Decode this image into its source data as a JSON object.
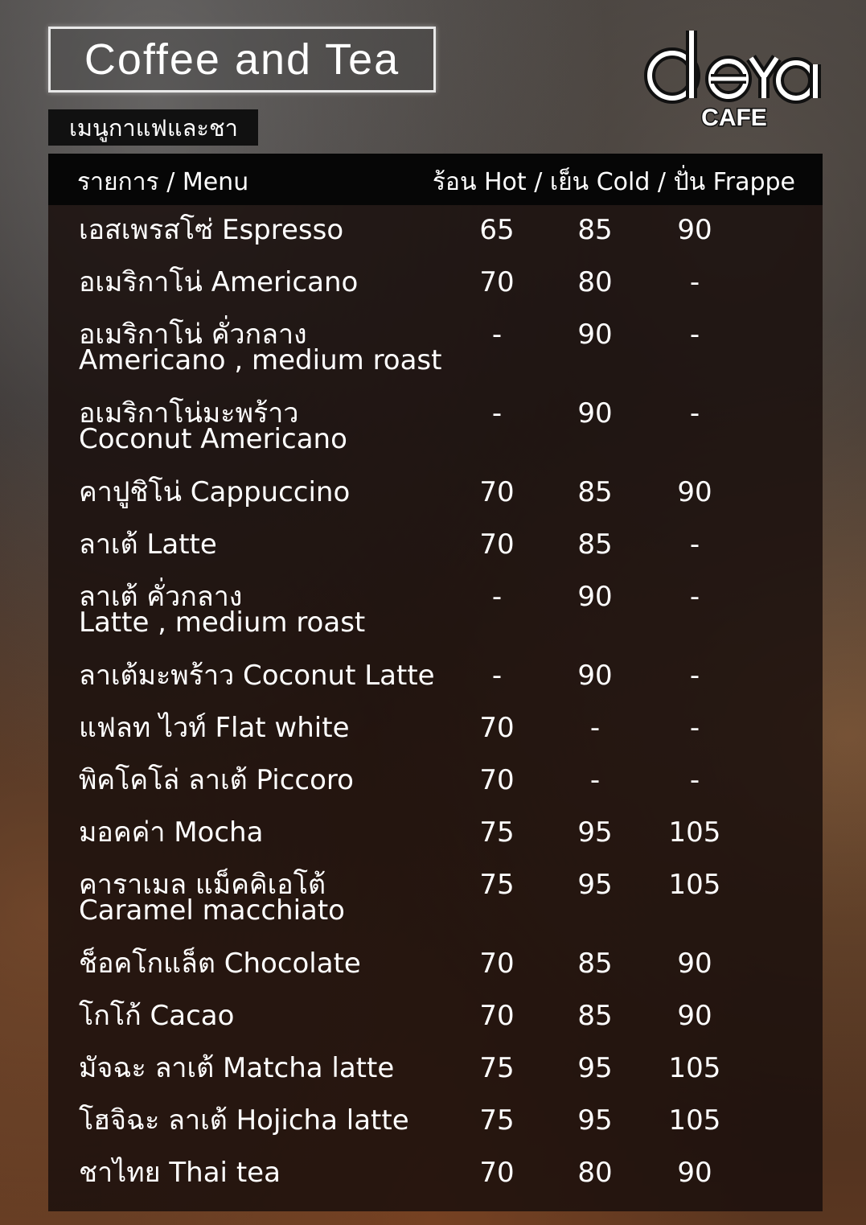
{
  "title": "Coffee and Tea",
  "subtitle": "เมนูกาแฟและชา",
  "logo_text": "deYa",
  "logo_sub": "CAFE",
  "header": {
    "menu": "รายการ / Menu",
    "columns": "ร้อน Hot / เย็น Cold / ปั่น Frappe"
  },
  "items": [
    {
      "name": "เอสเพรสโซ่ Espresso",
      "name2": "",
      "hot": "65",
      "cold": "85",
      "frappe": "90"
    },
    {
      "name": "อเมริกาโน่ Americano",
      "name2": "",
      "hot": "70",
      "cold": "80",
      "frappe": "-"
    },
    {
      "name": "อเมริกาโน่ คั่วกลาง",
      "name2": "Americano , medium roast",
      "hot": "-",
      "cold": "90",
      "frappe": "-"
    },
    {
      "name": "อเมริกาโน่มะพร้าว",
      "name2": "Coconut Americano",
      "hot": "-",
      "cold": "90",
      "frappe": "-"
    },
    {
      "name": "คาปูชิโน่ Cappuccino",
      "name2": "",
      "hot": "70",
      "cold": "85",
      "frappe": "90"
    },
    {
      "name": "ลาเต้ Latte",
      "name2": "",
      "hot": "70",
      "cold": "85",
      "frappe": "-"
    },
    {
      "name": "ลาเต้ คั่วกลาง",
      "name2": "Latte , medium roast",
      "hot": "-",
      "cold": "90",
      "frappe": "-"
    },
    {
      "name": "ลาเต้มะพร้าว Coconut Latte",
      "name2": "",
      "hot": "-",
      "cold": "90",
      "frappe": "-"
    },
    {
      "name": "แฟลท ไวท์ Flat white",
      "name2": "",
      "hot": "70",
      "cold": "-",
      "frappe": "-"
    },
    {
      "name": "พิคโคโล่ ลาเต้ Piccoro",
      "name2": "",
      "hot": "70",
      "cold": "-",
      "frappe": "-"
    },
    {
      "name": "มอคค่า Mocha",
      "name2": "",
      "hot": "75",
      "cold": "95",
      "frappe": "105"
    },
    {
      "name": "คาราเมล แม็คคิเอโต้",
      "name2": "Caramel macchiato",
      "hot": "75",
      "cold": "95",
      "frappe": "105"
    },
    {
      "name": "ช็อคโกแล็ต Chocolate",
      "name2": "",
      "hot": "70",
      "cold": "85",
      "frappe": "90"
    },
    {
      "name": "โกโก้ Cacao",
      "name2": "",
      "hot": "70",
      "cold": "85",
      "frappe": "90"
    },
    {
      "name": "มัจฉะ ลาเต้ Matcha latte",
      "name2": "",
      "hot": "75",
      "cold": "95",
      "frappe": "105"
    },
    {
      "name": "โฮจิฉะ ลาเต้ Hojicha latte",
      "name2": "",
      "hot": "75",
      "cold": "95",
      "frappe": "105"
    },
    {
      "name": "ชาไทย Thai tea",
      "name2": "",
      "hot": "70",
      "cold": "80",
      "frappe": "90"
    }
  ]
}
